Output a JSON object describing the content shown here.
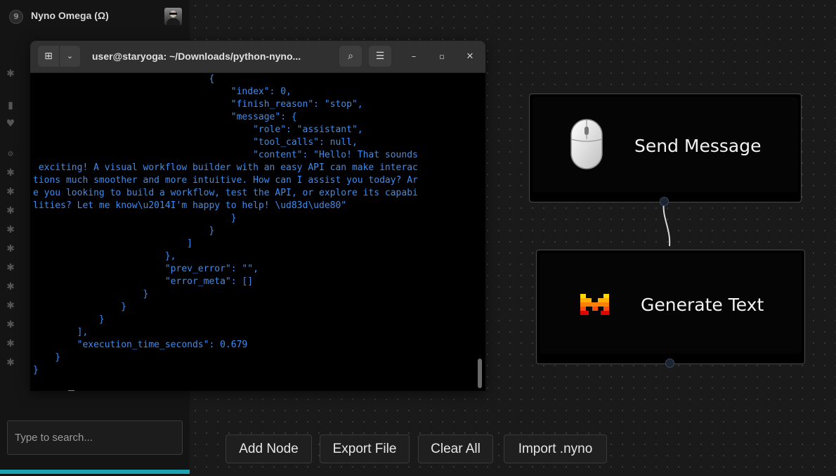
{
  "sidebar": {
    "app_logo": "9",
    "app_title": "Nyno Omega (Ω)",
    "search": {
      "placeholder": "Type to search...",
      "value": ""
    },
    "progress_fraction": 1.0,
    "progress_color": "#1da3b4",
    "icons": [
      "puzzle-icon",
      "database-icon",
      "heart-icon",
      "gear-icon",
      "puzzle-icon",
      "puzzle-icon",
      "puzzle-icon",
      "puzzle-icon",
      "puzzle-icon",
      "puzzle-icon",
      "puzzle-icon",
      "puzzle-icon",
      "puzzle-icon",
      "puzzle-icon",
      "puzzle-icon"
    ]
  },
  "terminal": {
    "title": "user@staryoga: ~/Downloads/python-nyno...",
    "lines": [
      "                                {",
      "                                    \"index\": 0,",
      "                                    \"finish_reason\": \"stop\",",
      "                                    \"message\": {",
      "                                        \"role\": \"assistant\",",
      "                                        \"tool_calls\": null,",
      "                                        \"content\": \"Hello! That sounds",
      " exciting! A visual workflow builder with an easy API can make interac",
      "tions much smoother and more intuitive. How can I assist you today? Ar",
      "e you looking to build a workflow, test the API, or explore its capabi",
      "lities? Let me know\\u2014I'm happy to help! \\ud83d\\ude80\"",
      "                                    }",
      "                                }",
      "                            ]",
      "                        },",
      "                        \"prev_error\": \"\",",
      "                        \"error_meta\": []",
      "                    }",
      "                }",
      "            }",
      "        ],",
      "        \"execution_time_seconds\": 0.679",
      "    }",
      "}"
    ],
    "prompt": "$ ",
    "text_color": "#3d8cf0"
  },
  "nodes": {
    "send_message": {
      "label": "Send Message",
      "icon": "mouse-icon"
    },
    "generate_text": {
      "label": "Generate Text",
      "icon": "mistral-logo-icon"
    }
  },
  "toolbar": {
    "add_node": "Add Node",
    "export_file": "Export File",
    "clear_all": "Clear All",
    "import_nyno": "Import .nyno"
  }
}
